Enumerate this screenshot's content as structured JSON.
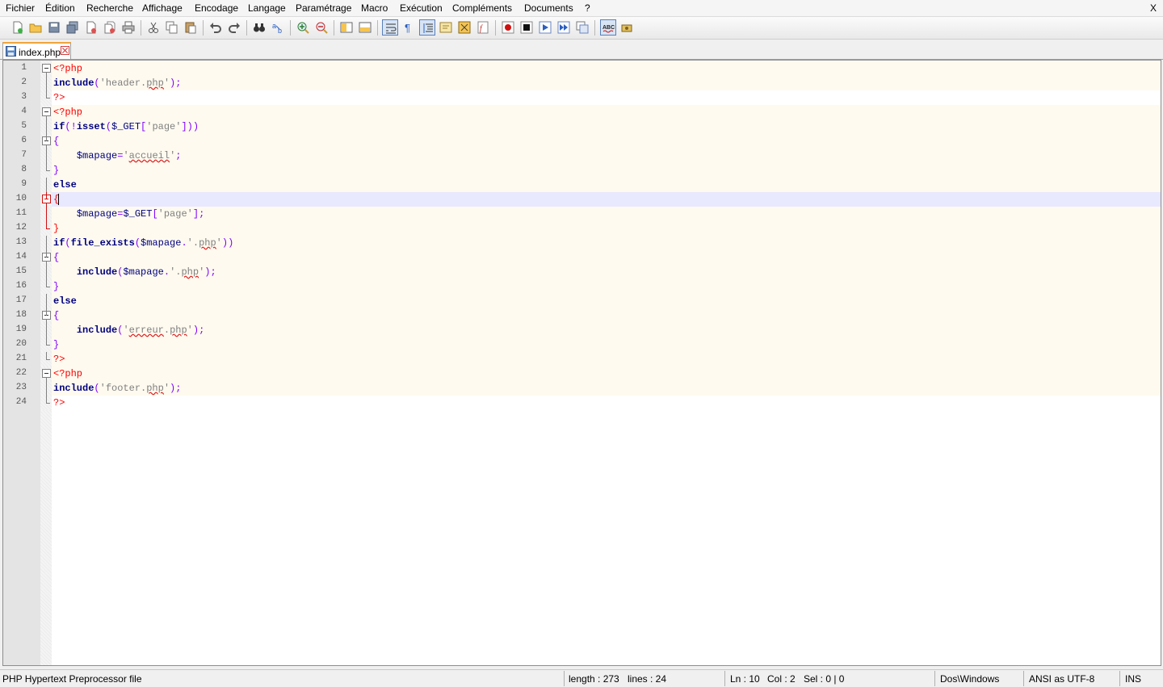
{
  "menu": {
    "items": [
      "Fichier",
      "Édition",
      "Recherche",
      "Affichage",
      "Encodage",
      "Langage",
      "Paramétrage",
      "Macro",
      "Exécution",
      "Compléments",
      "Documents",
      "?"
    ],
    "close_label": "X"
  },
  "toolbar": {
    "buttons": [
      "new-file",
      "open-file",
      "save",
      "save-all",
      "close",
      "close-all",
      "print",
      "cut",
      "copy",
      "paste",
      "undo",
      "redo",
      "find",
      "replace",
      "zoom-in",
      "zoom-out",
      "sync-vertical",
      "sync-horizontal",
      "word-wrap",
      "show-all-chars",
      "indent-guide",
      "user-defined-language",
      "document-map",
      "function-list",
      "record-macro",
      "stop-recording",
      "play-macro",
      "run-macro-multiple",
      "save-macro",
      "spell-check",
      "plugin"
    ]
  },
  "tab": {
    "filename": "index.php"
  },
  "editor": {
    "current_line": 10,
    "lines": [
      [
        {
          "c": "tag",
          "t": "<?php"
        }
      ],
      [
        {
          "c": "kw",
          "t": "include"
        },
        {
          "c": "op",
          "t": "("
        },
        {
          "c": "str",
          "t": "'header."
        },
        {
          "c": "spell",
          "t": "php"
        },
        {
          "c": "str",
          "t": "'"
        },
        {
          "c": "op",
          "t": ");"
        }
      ],
      [
        {
          "c": "tag",
          "t": "?>"
        }
      ],
      [
        {
          "c": "tag",
          "t": "<?php"
        }
      ],
      [
        {
          "c": "kw",
          "t": "if"
        },
        {
          "c": "op",
          "t": "(!"
        },
        {
          "c": "kw",
          "t": "isset"
        },
        {
          "c": "op",
          "t": "("
        },
        {
          "c": "var",
          "t": "$_GET"
        },
        {
          "c": "op",
          "t": "["
        },
        {
          "c": "str",
          "t": "'page'"
        },
        {
          "c": "op",
          "t": "]))"
        }
      ],
      [
        {
          "c": "op",
          "t": "{"
        }
      ],
      [
        {
          "c": "plain",
          "t": "    "
        },
        {
          "c": "var",
          "t": "$mapage"
        },
        {
          "c": "op",
          "t": "="
        },
        {
          "c": "str",
          "t": "'"
        },
        {
          "c": "spell",
          "t": "accueil"
        },
        {
          "c": "str",
          "t": "'"
        },
        {
          "c": "op",
          "t": ";"
        }
      ],
      [
        {
          "c": "op",
          "t": "}"
        }
      ],
      [
        {
          "c": "kw",
          "t": "else"
        }
      ],
      [
        {
          "c": "tag",
          "t": "{"
        }
      ],
      [
        {
          "c": "plain",
          "t": "    "
        },
        {
          "c": "var",
          "t": "$mapage"
        },
        {
          "c": "op",
          "t": "="
        },
        {
          "c": "var",
          "t": "$_GET"
        },
        {
          "c": "op",
          "t": "["
        },
        {
          "c": "str",
          "t": "'page'"
        },
        {
          "c": "op",
          "t": "];"
        }
      ],
      [
        {
          "c": "tag",
          "t": "}"
        }
      ],
      [
        {
          "c": "kw",
          "t": "if"
        },
        {
          "c": "op",
          "t": "("
        },
        {
          "c": "kw",
          "t": "file_exists"
        },
        {
          "c": "op",
          "t": "("
        },
        {
          "c": "var",
          "t": "$mapage"
        },
        {
          "c": "op",
          "t": "."
        },
        {
          "c": "str",
          "t": "'."
        },
        {
          "c": "spell",
          "t": "php"
        },
        {
          "c": "str",
          "t": "'"
        },
        {
          "c": "op",
          "t": "))"
        }
      ],
      [
        {
          "c": "op",
          "t": "{"
        }
      ],
      [
        {
          "c": "plain",
          "t": "    "
        },
        {
          "c": "kw",
          "t": "include"
        },
        {
          "c": "op",
          "t": "("
        },
        {
          "c": "var",
          "t": "$mapage"
        },
        {
          "c": "op",
          "t": "."
        },
        {
          "c": "str",
          "t": "'."
        },
        {
          "c": "spell",
          "t": "php"
        },
        {
          "c": "str",
          "t": "'"
        },
        {
          "c": "op",
          "t": ");"
        }
      ],
      [
        {
          "c": "op",
          "t": "}"
        }
      ],
      [
        {
          "c": "kw",
          "t": "else"
        }
      ],
      [
        {
          "c": "op",
          "t": "{"
        }
      ],
      [
        {
          "c": "plain",
          "t": "    "
        },
        {
          "c": "kw",
          "t": "include"
        },
        {
          "c": "op",
          "t": "("
        },
        {
          "c": "str",
          "t": "'"
        },
        {
          "c": "spell",
          "t": "erreur"
        },
        {
          "c": "str",
          "t": "."
        },
        {
          "c": "spell",
          "t": "php"
        },
        {
          "c": "str",
          "t": "'"
        },
        {
          "c": "op",
          "t": ");"
        }
      ],
      [
        {
          "c": "op",
          "t": "}"
        }
      ],
      [
        {
          "c": "tag",
          "t": "?>"
        }
      ],
      [
        {
          "c": "tag",
          "t": "<?php"
        }
      ],
      [
        {
          "c": "kw",
          "t": "include"
        },
        {
          "c": "op",
          "t": "("
        },
        {
          "c": "str",
          "t": "'footer."
        },
        {
          "c": "spell",
          "t": "php"
        },
        {
          "c": "str",
          "t": "'"
        },
        {
          "c": "op",
          "t": ");"
        }
      ],
      [
        {
          "c": "tag",
          "t": "?>"
        }
      ]
    ],
    "folds": [
      "open",
      "mid",
      "end",
      "open",
      "mid",
      "open",
      "mid",
      "end",
      "mid",
      "open",
      "mid",
      "end",
      "mid",
      "open",
      "mid",
      "end",
      "mid",
      "open",
      "mid",
      "end",
      "end",
      "open",
      "mid",
      "end"
    ]
  },
  "status": {
    "language": "PHP Hypertext Preprocessor file",
    "length": "length : 273",
    "lines": "lines : 24",
    "ln": "Ln : 10",
    "col": "Col : 2",
    "sel": "Sel : 0 | 0",
    "eol": "Dos\\Windows",
    "encoding": "ANSI as UTF-8",
    "mode": "INS"
  },
  "colors": {
    "tag": "#ff0000",
    "keyword": "#00007f",
    "string": "#808080",
    "operator": "#8000ff",
    "current_line": "#e8e8ff",
    "php_block_bg": "#fefaef",
    "tab_accent": "#f0a43a"
  }
}
